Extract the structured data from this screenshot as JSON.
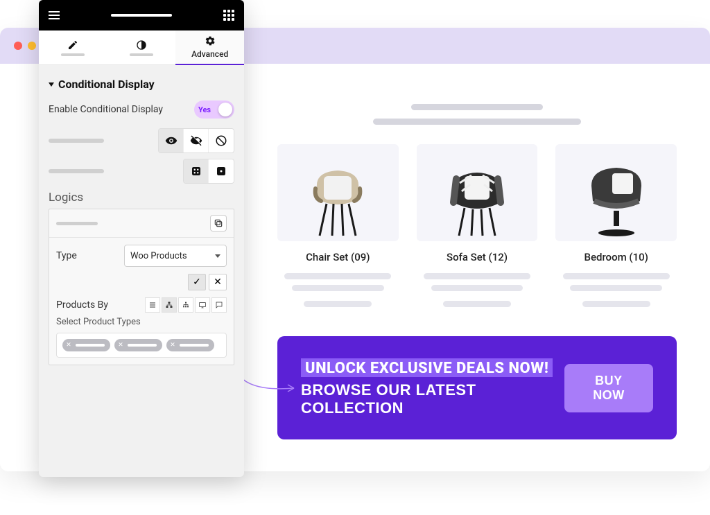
{
  "editor": {
    "tabs": {
      "advanced_label": "Advanced"
    },
    "section_title": "Conditional Display",
    "enable_label": "Enable Conditional Display",
    "toggle_value": "Yes",
    "logics_label": "Logics",
    "type_label": "Type",
    "type_value": "Woo Products",
    "products_by_label": "Products By",
    "select_product_types_label": "Select Product Types"
  },
  "preview": {
    "cards": [
      {
        "title": "Chair Set (09)"
      },
      {
        "title": "Sofa Set (12)"
      },
      {
        "title": "Bedroom (10)"
      }
    ],
    "banner": {
      "line1": "Unlock exclusive deals now!",
      "line2": "Browse our latest collection",
      "button": "Buy Now"
    }
  }
}
